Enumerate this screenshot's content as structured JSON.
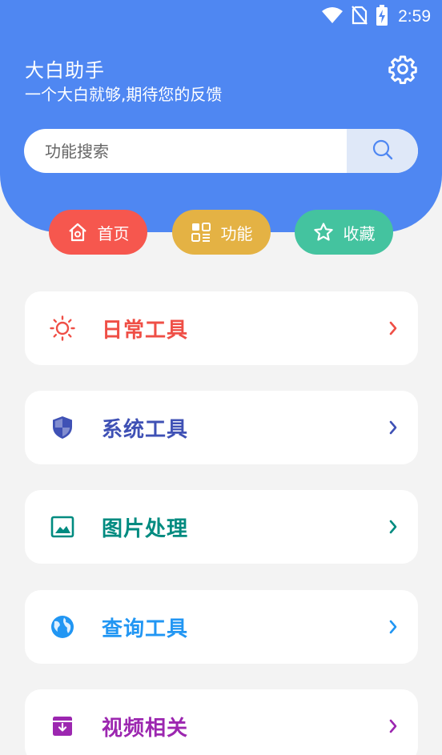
{
  "status_bar": {
    "time": "2:59"
  },
  "header": {
    "title": "大白助手",
    "subtitle": "一个大白就够,期待您的反馈"
  },
  "search": {
    "placeholder": "功能搜索",
    "value": ""
  },
  "tabs": [
    {
      "label": "首页",
      "icon": "home-icon",
      "color": "#f6574e"
    },
    {
      "label": "功能",
      "icon": "grid-icon",
      "color": "#e4b244"
    },
    {
      "label": "收藏",
      "icon": "star-icon",
      "color": "#44c39f"
    }
  ],
  "categories": [
    {
      "label": "日常工具",
      "icon": "sun-icon",
      "color": "#ef4f46"
    },
    {
      "label": "系统工具",
      "icon": "shield-icon",
      "color": "#3f51b5"
    },
    {
      "label": "图片处理",
      "icon": "image-icon",
      "color": "#008b80"
    },
    {
      "label": "查询工具",
      "icon": "globe-icon",
      "color": "#2196f3"
    },
    {
      "label": "视频相关",
      "icon": "archive-icon",
      "color": "#9c27b0"
    }
  ],
  "colors": {
    "header_bg": "#4f87f2",
    "page_bg": "#f3f3f3"
  }
}
